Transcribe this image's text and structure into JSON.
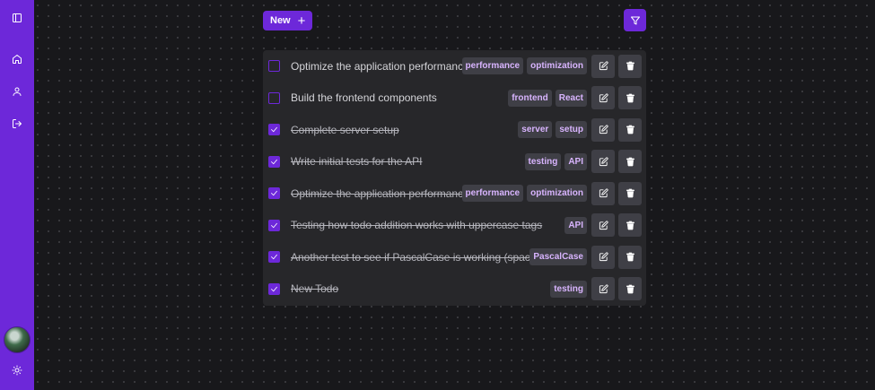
{
  "toolbar": {
    "new_label": "New",
    "plus_icon": "+"
  },
  "colors": {
    "accent": "#6d28d9",
    "tag_text": "#d8b4fe",
    "panel": "#27272a"
  },
  "sidebar": {
    "items": [
      {
        "icon": "sidebar-toggle-icon"
      },
      {
        "icon": "home-icon"
      },
      {
        "icon": "user-icon"
      },
      {
        "icon": "logout-icon"
      }
    ],
    "bottom": [
      {
        "icon": "avatar"
      },
      {
        "icon": "sun-icon"
      }
    ]
  },
  "todos": [
    {
      "title": "Optimize the application performance",
      "done": false,
      "tags": [
        "performance",
        "optimization"
      ]
    },
    {
      "title": "Build the frontend components",
      "done": false,
      "tags": [
        "frontend",
        "React"
      ]
    },
    {
      "title": "Complete server setup",
      "done": true,
      "tags": [
        "server",
        "setup"
      ]
    },
    {
      "title": "Write initial tests for the API",
      "done": true,
      "tags": [
        "testing",
        "API"
      ]
    },
    {
      "title": "Optimize the application performance",
      "done": true,
      "tags": [
        "performance",
        "optimization"
      ]
    },
    {
      "title": "Testing how todo addition works with uppercase tags",
      "done": true,
      "tags": [
        "API"
      ]
    },
    {
      "title": "Another test to see if PascalCase is working (spacing)",
      "done": true,
      "tags": [
        "PascalCase"
      ]
    },
    {
      "title": "New Todo",
      "done": true,
      "tags": [
        "testing"
      ]
    }
  ]
}
